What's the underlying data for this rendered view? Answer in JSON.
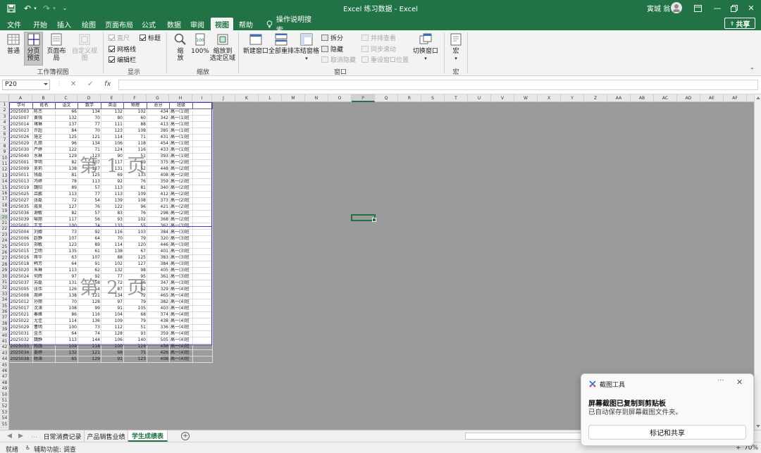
{
  "titlebar": {
    "title": "Excel 练习数据  -  Excel",
    "user": "寅城 翁",
    "quick_access": [
      "save-icon",
      "undo-icon",
      "redo-icon",
      "customize-icon"
    ]
  },
  "ribbon_tabs": [
    "文件",
    "开始",
    "插入",
    "绘图",
    "页面布局",
    "公式",
    "数据",
    "审阅",
    "视图",
    "帮助",
    "操作说明搜索"
  ],
  "active_tab": "视图",
  "share_label": "共享",
  "ribbon": {
    "workbook_views": {
      "label": "工作簿视图",
      "normal": "普通",
      "page_break_1": "分页",
      "page_break_2": "预览",
      "page_layout": "页面布局",
      "custom_views": "自定义视图"
    },
    "show": {
      "label": "显示",
      "ruler": "直尺",
      "gridlines": "网格线",
      "formula_bar": "编辑栏",
      "headings": "标题"
    },
    "zoom": {
      "label": "缩放",
      "zoom_1": "缩",
      "zoom_2": "放",
      "hundred": "100%",
      "to_selection_1": "缩放到",
      "to_selection_2": "选定区域"
    },
    "window": {
      "label": "窗口",
      "new_window": "新建窗口",
      "arrange_all": "全部重排",
      "freeze_panes": "冻结窗格",
      "split": "拆分",
      "hide": "隐藏",
      "unhide": "取消隐藏",
      "side_by_side": "并排查看",
      "sync_scroll": "同步滚动",
      "reset_position": "重设窗口位置",
      "switch_windows": "切换窗口"
    },
    "macros": {
      "label": "宏",
      "macros": "宏"
    }
  },
  "formula_bar": {
    "name_box": "P20",
    "cancel": "✕",
    "enter": "✓",
    "fx": "fx",
    "value": ""
  },
  "columns": [
    "A",
    "B",
    "C",
    "D",
    "E",
    "F",
    "G",
    "H",
    "I",
    "J",
    "K",
    "L",
    "M",
    "N",
    "O",
    "P",
    "Q",
    "R",
    "S",
    "T",
    "U",
    "V",
    "W",
    "X",
    "Y",
    "Z",
    "AA",
    "AB",
    "AC",
    "AD",
    "AE",
    "AF",
    "AG"
  ],
  "selected_cell": {
    "column": "P",
    "row": 20
  },
  "sheet_headers": [
    "学号",
    "姓名",
    "语文",
    "数学",
    "英语",
    "物理",
    "总分",
    "班级"
  ],
  "rows": [
    [
      "2025003",
      "陈杰",
      "66",
      "134",
      "132",
      "102",
      "434",
      "高一(1)班"
    ],
    [
      "2025007",
      "黄强",
      "132",
      "70",
      "80",
      "60",
      "342",
      "高一(1)班"
    ],
    [
      "2025014",
      "褚琳",
      "137",
      "77",
      "111",
      "88",
      "413",
      "高一(1)班"
    ],
    [
      "2025023",
      "许超",
      "84",
      "70",
      "123",
      "108",
      "385",
      "高一(1)班"
    ],
    [
      "2025026",
      "施芝",
      "125",
      "121",
      "114",
      "71",
      "431",
      "高一(1)班"
    ],
    [
      "2025029",
      "孔丽",
      "96",
      "134",
      "106",
      "118",
      "454",
      "高一(1)班"
    ],
    [
      "2025030",
      "严婷",
      "122",
      "71",
      "124",
      "116",
      "433",
      "高一(1)班"
    ],
    [
      "2025040",
      "水琳",
      "129",
      "123",
      "90",
      "51",
      "393",
      "高一(1)班"
    ],
    [
      "2025001",
      "李明",
      "82",
      "107",
      "117",
      "69",
      "375",
      "高一(2)班"
    ],
    [
      "2025009",
      "吴莉",
      "138",
      "127",
      "131",
      "52",
      "448",
      "高一(2)班"
    ],
    [
      "2025011",
      "钱磊",
      "81",
      "125",
      "69",
      "133",
      "408",
      "高一(2)班"
    ],
    [
      "2025013",
      "冯婷",
      "78",
      "113",
      "92",
      "76",
      "359",
      "高一(2)班"
    ],
    [
      "2025019",
      "魏阳",
      "89",
      "57",
      "113",
      "81",
      "340",
      "高一(2)班"
    ],
    [
      "2025025",
      "吕鹏",
      "113",
      "77",
      "113",
      "109",
      "412",
      "高一(2)班"
    ],
    [
      "2025027",
      "张磊",
      "72",
      "54",
      "139",
      "108",
      "373",
      "高一(2)班"
    ],
    [
      "2025035",
      "戚昊",
      "127",
      "76",
      "122",
      "96",
      "421",
      "高一(2)班"
    ],
    [
      "2025036",
      "谢敏",
      "82",
      "57",
      "83",
      "76",
      "298",
      "高一(2)班"
    ],
    [
      "2025039",
      "喻丽",
      "117",
      "56",
      "93",
      "102",
      "368",
      "高一(2)班"
    ],
    [
      "2025002",
      "王芳",
      "100",
      "74",
      "133",
      "55",
      "362",
      "高一(3)班"
    ],
    [
      "2025004",
      "刘娜",
      "73",
      "92",
      "116",
      "103",
      "384",
      "高一(3)班"
    ],
    [
      "2025006",
      "赵静",
      "107",
      "64",
      "70",
      "79",
      "320",
      "高一(3)班"
    ],
    [
      "2025010",
      "郑敏",
      "123",
      "89",
      "114",
      "120",
      "446",
      "高一(3)班"
    ],
    [
      "2025015",
      "卫明",
      "135",
      "61",
      "138",
      "67",
      "401",
      "高一(3)班"
    ],
    [
      "2025016",
      "蒋华",
      "63",
      "107",
      "88",
      "125",
      "383",
      "高一(3)班"
    ],
    [
      "2025018",
      "韩芳",
      "64",
      "91",
      "102",
      "127",
      "384",
      "高一(3)班"
    ],
    [
      "2025020",
      "朱琳",
      "113",
      "62",
      "132",
      "98",
      "405",
      "高一(3)班"
    ],
    [
      "2025024",
      "何辉",
      "97",
      "92",
      "77",
      "95",
      "361",
      "高一(3)班"
    ],
    [
      "2025037",
      "苏磊",
      "131",
      "58",
      "72",
      "86",
      "347",
      "高一(3)班"
    ],
    [
      "2025005",
      "张伟",
      "126",
      "54",
      "87",
      "62",
      "329",
      "高一(4)班"
    ],
    [
      "2025008",
      "周婷",
      "138",
      "121",
      "134",
      "72",
      "465",
      "高一(4)班"
    ],
    [
      "2025012",
      "孙丽",
      "70",
      "128",
      "97",
      "79",
      "382",
      "高一(4)班"
    ],
    [
      "2025017",
      "沈涛",
      "108",
      "99",
      "91",
      "105",
      "403",
      "高一(4)班"
    ],
    [
      "2025021",
      "秦峰",
      "86",
      "116",
      "104",
      "68",
      "374",
      "高一(4)班"
    ],
    [
      "2025022",
      "尤佳",
      "114",
      "136",
      "109",
      "79",
      "438",
      "高一(4)班"
    ],
    [
      "2025029",
      "曹明",
      "100",
      "73",
      "112",
      "51",
      "336",
      "高一(4)班"
    ],
    [
      "2025031",
      "金杰",
      "64",
      "74",
      "128",
      "93",
      "359",
      "高一(4)班"
    ],
    [
      "2025032",
      "魏静",
      "113",
      "144",
      "106",
      "140",
      "505",
      "高一(4)班"
    ],
    [
      "2025033",
      "陶强",
      "109",
      "118",
      "100",
      "129",
      "456",
      "高一(4)班"
    ],
    [
      "2025034",
      "姜婷",
      "132",
      "121",
      "98",
      "75",
      "426",
      "高一(4)班"
    ],
    [
      "2025038",
      "杨涛",
      "65",
      "129",
      "91",
      "123",
      "408",
      "高一(4)班"
    ]
  ],
  "page_labels": [
    "第 1 页",
    "第 2 页"
  ],
  "sheet_tabs": [
    "日常消费记录",
    "产品销售业绩",
    "学生成绩表"
  ],
  "active_sheet": "学生成绩表",
  "statusbar": {
    "ready": "就绪",
    "accessibility": "辅助功能: 调查",
    "zoom": "70%"
  },
  "toast": {
    "app": "截图工具",
    "more": "···",
    "close": "✕",
    "title": "屏幕截图已复制到剪贴板",
    "body": "已自动保存到屏幕截图文件夹。",
    "button": "标记和共享"
  }
}
